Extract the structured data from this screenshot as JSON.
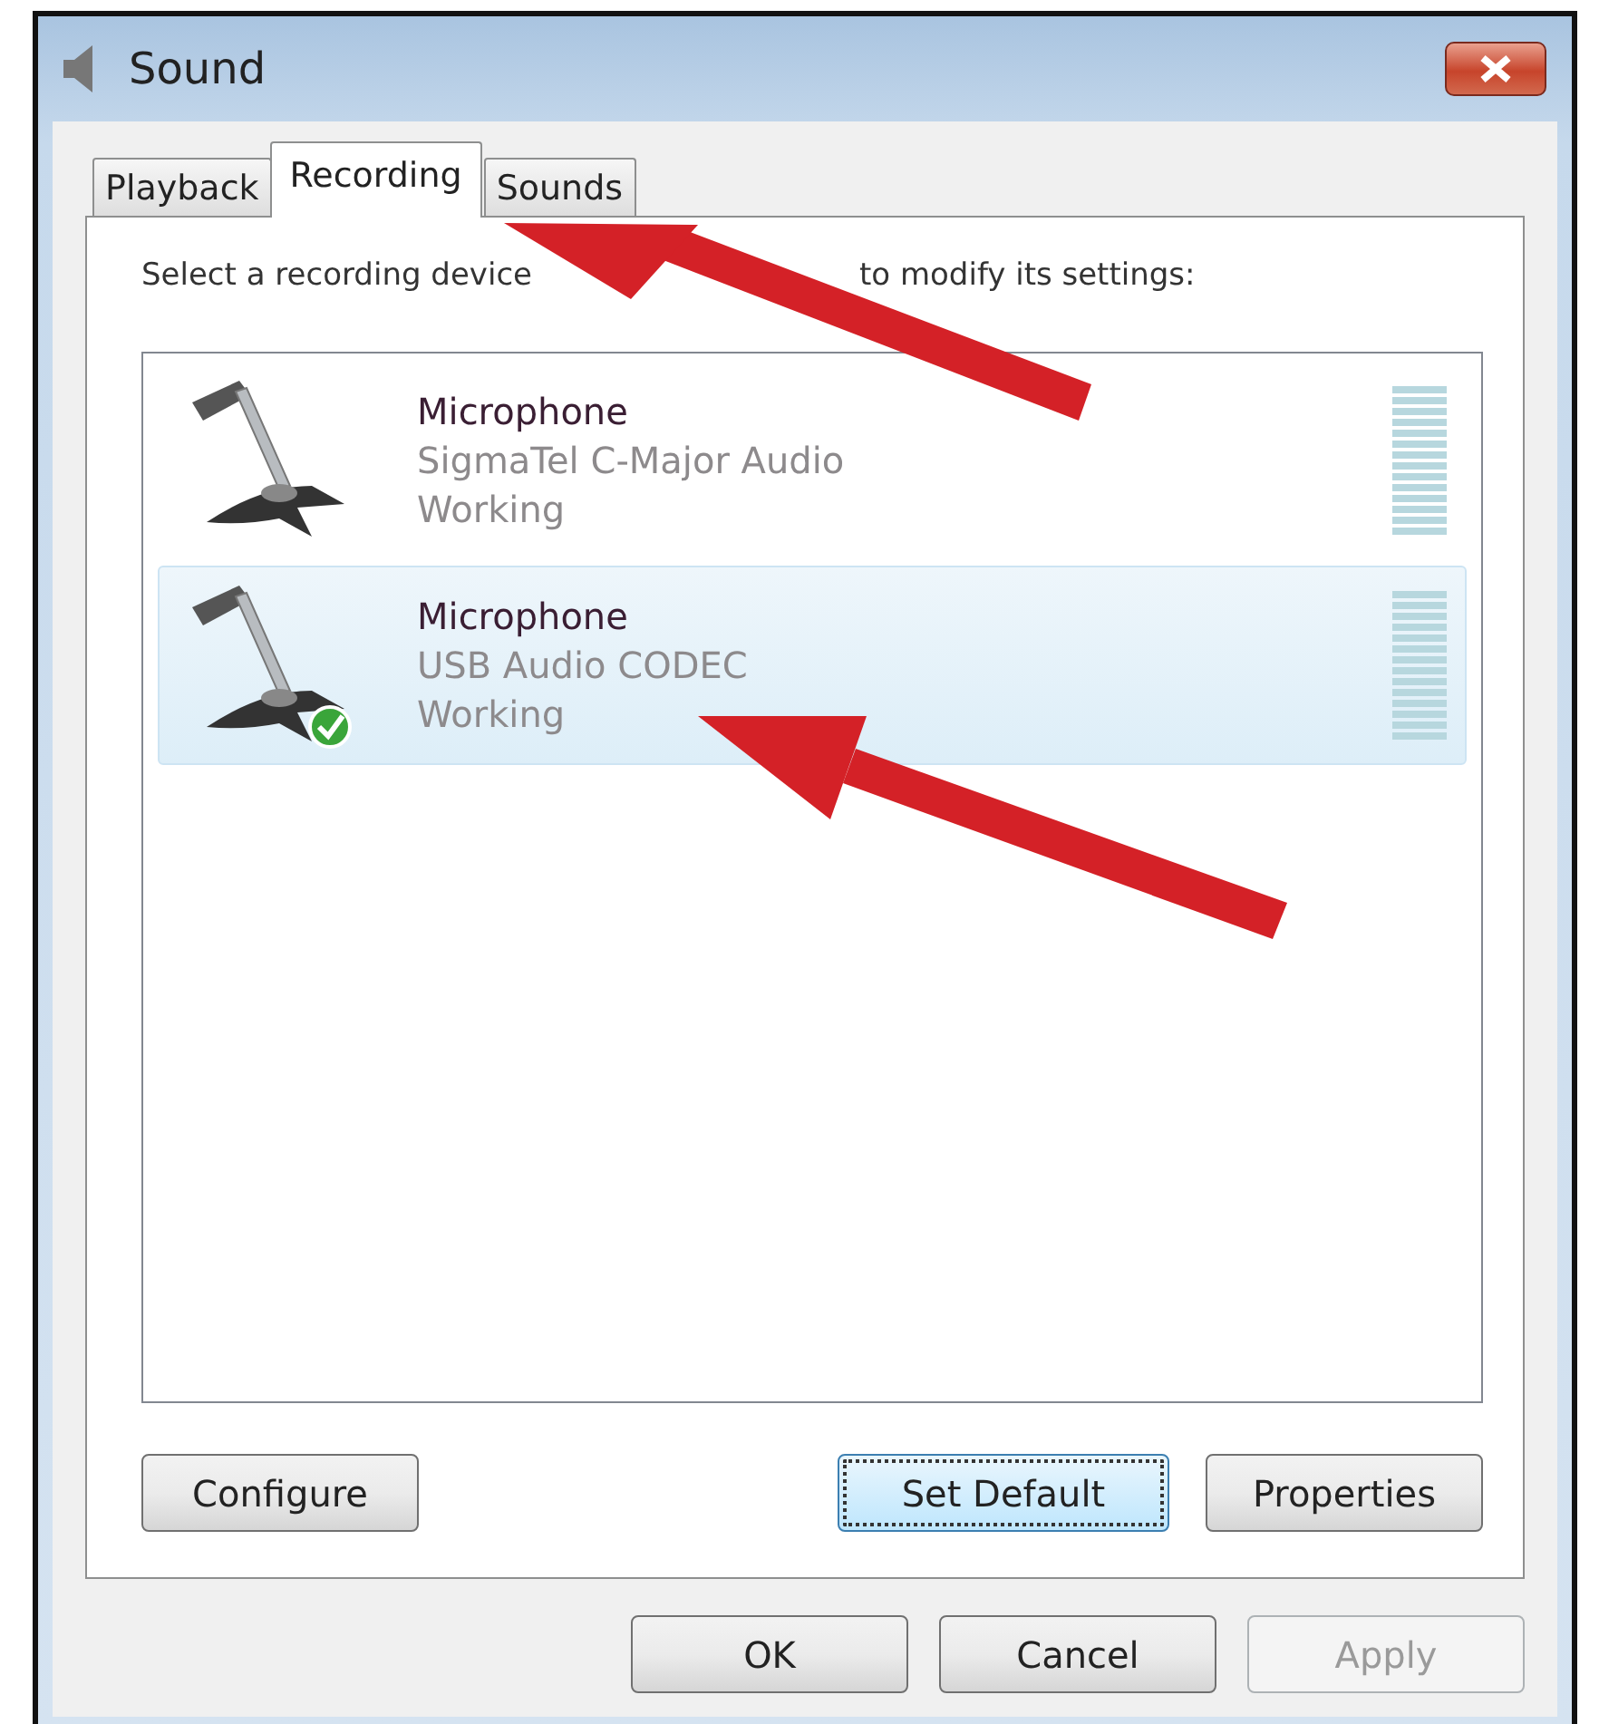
{
  "window": {
    "title": "Sound"
  },
  "tabs": [
    {
      "label": "Playback",
      "selected": false
    },
    {
      "label": "Recording",
      "selected": true
    },
    {
      "label": "Sounds",
      "selected": false
    }
  ],
  "instruction_parts": [
    "Select a recording device",
    "to modify its settings:"
  ],
  "devices": [
    {
      "name": "Microphone",
      "description": "SigmaTel C-Major Audio",
      "status": "Working",
      "selected": false,
      "default": false
    },
    {
      "name": "Microphone",
      "description": "USB Audio CODEC",
      "status": "Working",
      "selected": true,
      "default": true
    }
  ],
  "device_buttons": [
    {
      "label": "Configure",
      "focused": false
    },
    {
      "label": "Set Default",
      "focused": true
    },
    {
      "label": "Properties",
      "focused": false
    }
  ],
  "dialog_buttons": [
    {
      "label": "OK",
      "disabled": false
    },
    {
      "label": "Cancel",
      "disabled": false
    },
    {
      "label": "Apply",
      "disabled": true
    }
  ]
}
